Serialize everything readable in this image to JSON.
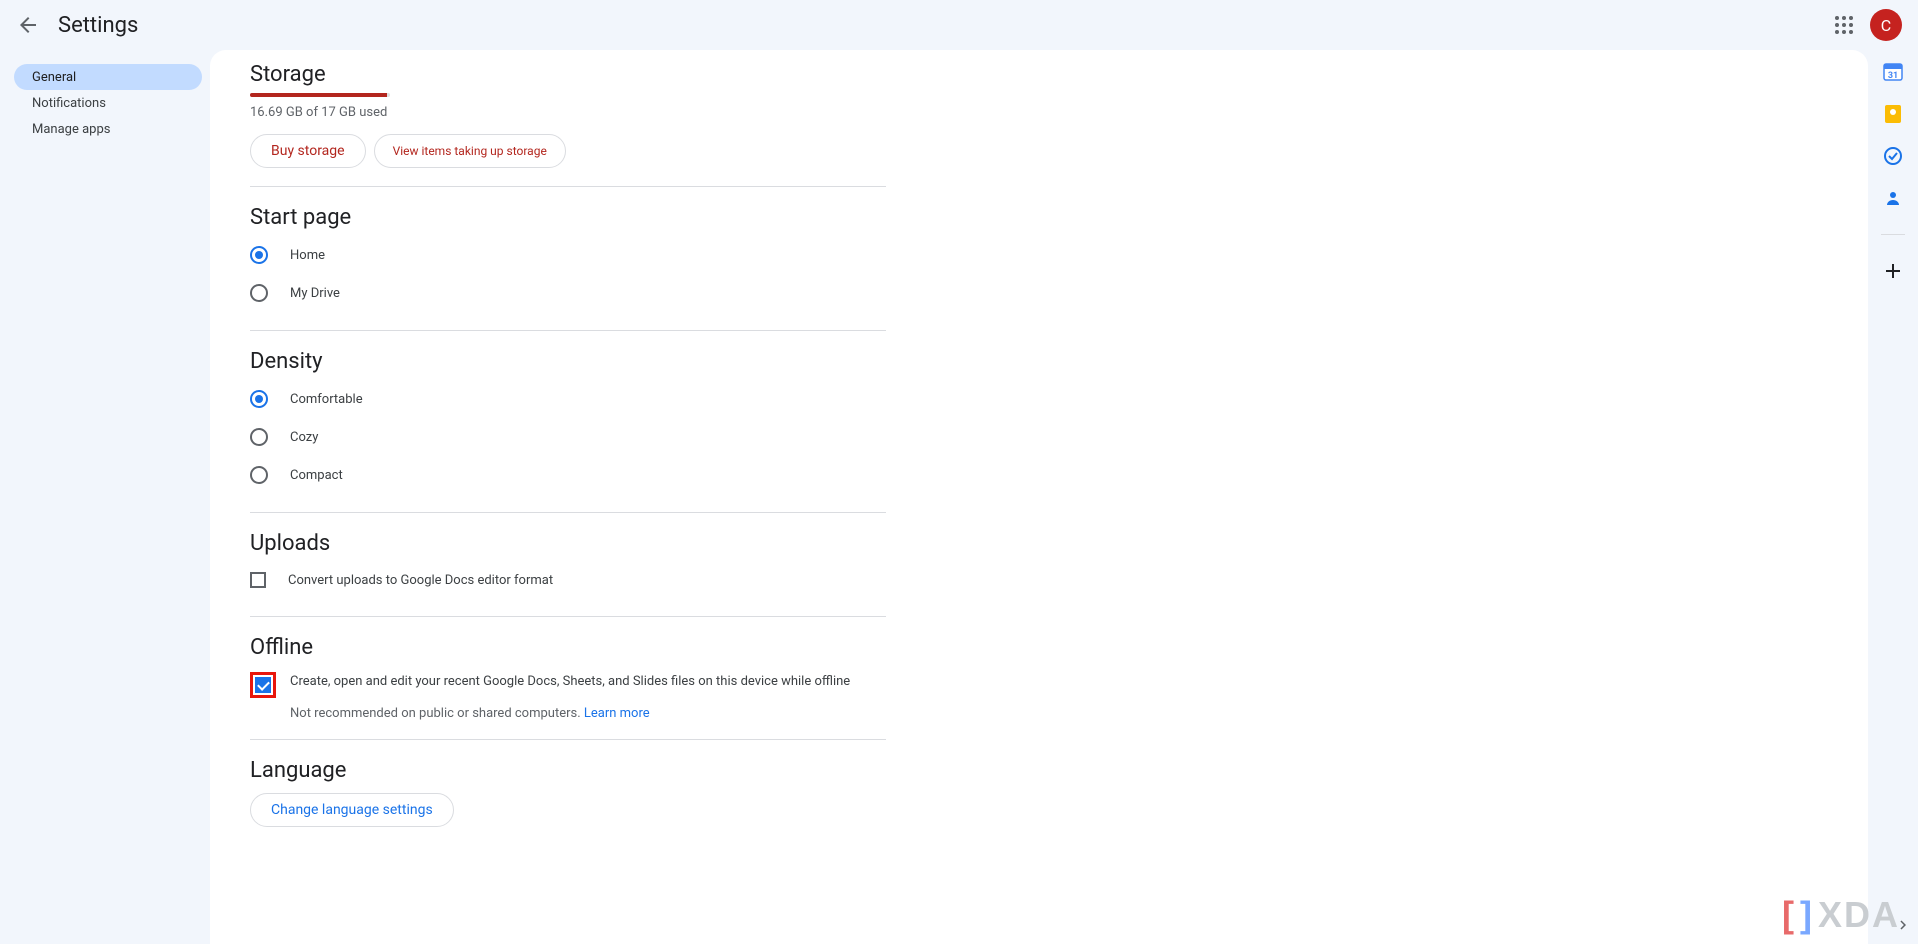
{
  "header": {
    "title": "Settings",
    "avatar_initial": "C"
  },
  "sidebar": {
    "items": [
      {
        "label": "General",
        "active": true
      },
      {
        "label": "Notifications",
        "active": false
      },
      {
        "label": "Manage apps",
        "active": false
      }
    ]
  },
  "storage": {
    "heading": "Storage",
    "usage_text": "16.69 GB of 17 GB used",
    "buy_label": "Buy storage",
    "view_label": "View items taking up storage"
  },
  "startpage": {
    "heading": "Start page",
    "options": [
      {
        "label": "Home",
        "checked": true
      },
      {
        "label": "My Drive",
        "checked": false
      }
    ]
  },
  "density": {
    "heading": "Density",
    "options": [
      {
        "label": "Comfortable",
        "checked": true
      },
      {
        "label": "Cozy",
        "checked": false
      },
      {
        "label": "Compact",
        "checked": false
      }
    ]
  },
  "uploads": {
    "heading": "Uploads",
    "option_label": "Convert uploads to Google Docs editor format",
    "checked": false
  },
  "offline": {
    "heading": "Offline",
    "option_label": "Create, open and edit your recent Google Docs, Sheets, and Slides files on this device while offline",
    "checked": true,
    "subtext_prefix": "Not recommended on public or shared computers. ",
    "learn_more": "Learn more"
  },
  "language": {
    "heading": "Language",
    "button_label": "Change language settings"
  }
}
